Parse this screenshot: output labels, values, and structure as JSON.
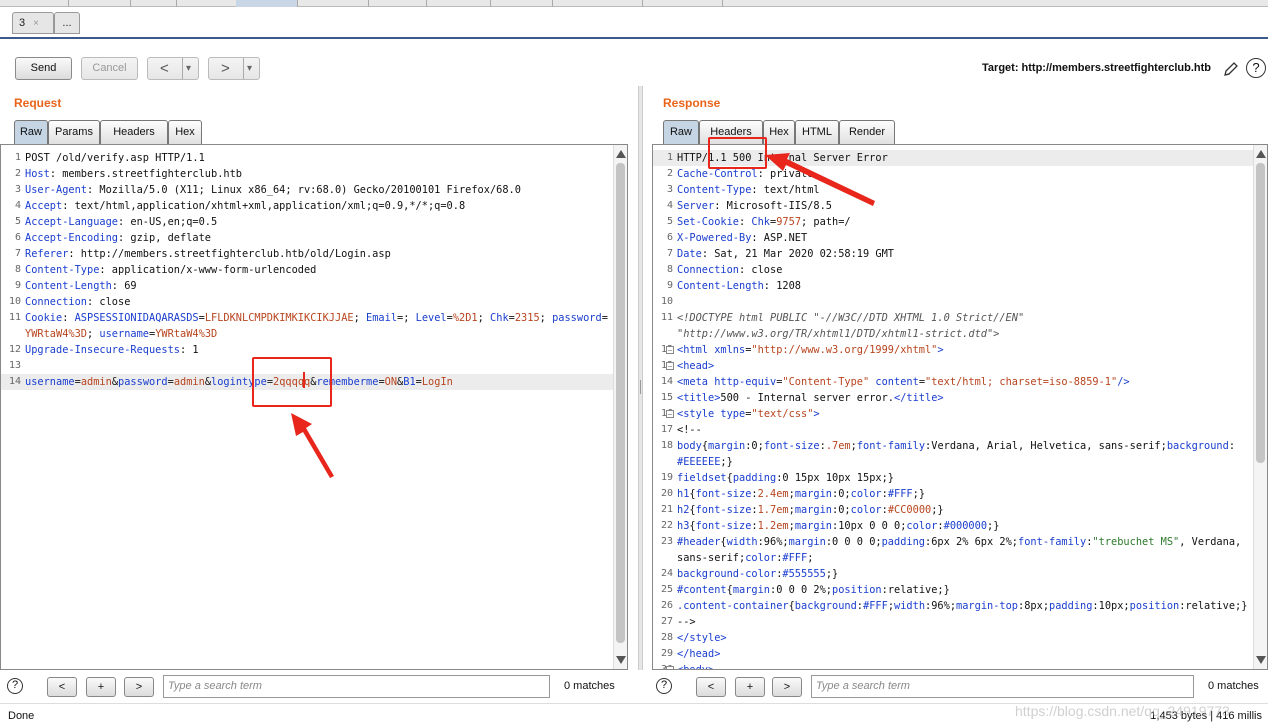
{
  "top_tabs": {
    "repeater_tab": "3",
    "close_glyph": "×",
    "new_tab": "..."
  },
  "toolbar": {
    "send": "Send",
    "cancel": "Cancel",
    "back": "<",
    "forward": ">",
    "dropdown": "▾",
    "target": "Target: http://members.streetfighterclub.htb",
    "help": "?"
  },
  "request": {
    "title": "Request",
    "tabs": [
      "Raw",
      "Params",
      "Headers",
      "Hex"
    ],
    "lines": [
      {
        "n": "1",
        "html": "POST /old/verify.asp HTTP/1.1"
      },
      {
        "n": "2",
        "html": "<span class='k'>Host</span>: members.streetfighterclub.htb"
      },
      {
        "n": "3",
        "html": "<span class='k'>User-Agent</span>: Mozilla/5.0 (X11; Linux x86_64; rv:68.0) Gecko/20100101 Firefox/68.0"
      },
      {
        "n": "4",
        "html": "<span class='k'>Accept</span>: text/html,application/xhtml+xml,application/xml;q=0.9,*/*;q=0.8"
      },
      {
        "n": "5",
        "html": "<span class='k'>Accept-Language</span>: en-US,en;q=0.5"
      },
      {
        "n": "6",
        "html": "<span class='k'>Accept-Encoding</span>: gzip, deflate"
      },
      {
        "n": "7",
        "html": "<span class='k'>Referer</span>: http://members.streetfighterclub.htb/old/Login.asp"
      },
      {
        "n": "8",
        "html": "<span class='k'>Content-Type</span>: application/x-www-form-urlencoded"
      },
      {
        "n": "9",
        "html": "<span class='k'>Content-Length</span>: 69"
      },
      {
        "n": "10",
        "html": "<span class='k'>Connection</span>: close"
      },
      {
        "n": "11",
        "html": "<span class='k'>Cookie</span>: <span class='k'>ASPSESSIONIDAQARASDS</span>=<span class='v'>LFLDKNLCMPDKIMKIKCIKJJAE</span>; <span class='k'>Email</span>=; <span class='k'>Level</span>=<span class='v'>%2D1</span>; <span class='k'>Chk</span>=<span class='v'>2315</span>; <span class='k'>password</span>="
      },
      {
        "n": "",
        "html": "<span class='v'>YWRtaW4%3D</span>; <span class='k'>username</span>=<span class='v'>YWRtaW4%3D</span>"
      },
      {
        "n": "12",
        "html": "<span class='k'>Upgrade-Insecure-Requests</span>: 1"
      },
      {
        "n": "13",
        "html": ""
      },
      {
        "n": "14",
        "html": "<span class='k'>username</span>=<span class='v'>admin</span>&amp;<span class='k'>password</span>=<span class='v'>admin</span>&amp;<span class='k'>logintype</span>=<span class='v'>2qqqqq</span>&amp;<span class='k'>rememberme</span>=<span class='v'>ON</span>&amp;<span class='k'>B1</span>=<span class='v'>LogIn</span>",
        "hl": true
      }
    ],
    "search_placeholder": "Type a search term",
    "matches": "0 matches"
  },
  "response": {
    "title": "Response",
    "tabs": [
      "Raw",
      "Headers",
      "Hex",
      "HTML",
      "Render"
    ],
    "lines": [
      {
        "n": "1",
        "html": "HTTP/1.1 500 Internal Server Error",
        "hl": true
      },
      {
        "n": "2",
        "html": "<span class='k'>Cache-Control</span>: private"
      },
      {
        "n": "3",
        "html": "<span class='k'>Content-Type</span>: text/html"
      },
      {
        "n": "4",
        "html": "<span class='k'>Server</span>: Microsoft-IIS/8.5"
      },
      {
        "n": "5",
        "html": "<span class='k'>Set-Cookie</span>: <span class='k'>Chk</span>=<span class='v'>9757</span>; path=/"
      },
      {
        "n": "6",
        "html": "<span class='k'>X-Powered-By</span>: ASP.NET"
      },
      {
        "n": "7",
        "html": "<span class='k'>Date</span>: Sat, 21 Mar 2020 02:58:19 GMT"
      },
      {
        "n": "8",
        "html": "<span class='k'>Connection</span>: close"
      },
      {
        "n": "9",
        "html": "<span class='k'>Content-Length</span>: 1208"
      },
      {
        "n": "10",
        "html": ""
      },
      {
        "n": "11",
        "html": "<span class='cm'>&lt;!DOCTYPE html PUBLIC \"-//W3C//DTD XHTML 1.0 Strict//EN\"</span>"
      },
      {
        "n": "",
        "html": "<span class='cm'>\"http://www.w3.org/TR/xhtml1/DTD/xhtml1-strict.dtd\"&gt;</span>"
      },
      {
        "n": "12",
        "fold": true,
        "html": "<span class='tg'>&lt;html</span> <span class='k'>xmlns</span>=<span class='v'>\"http://www.w3.org/1999/xhtml\"</span><span class='tg'>&gt;</span>"
      },
      {
        "n": "13",
        "fold": true,
        "html": "<span class='tg'>&lt;head&gt;</span>"
      },
      {
        "n": "14",
        "html": "<span class='tg'>&lt;meta</span> <span class='k'>http-equiv</span>=<span class='v'>\"Content-Type\"</span> <span class='k'>content</span>=<span class='v'>\"text/html; charset=iso-8859-1\"</span><span class='tg'>/&gt;</span>"
      },
      {
        "n": "15",
        "html": "<span class='tg'>&lt;title&gt;</span>500 - Internal server error.<span class='tg'>&lt;/title&gt;</span>"
      },
      {
        "n": "16",
        "fold": true,
        "html": "<span class='tg'>&lt;style</span> <span class='k'>type</span>=<span class='v'>\"text/css\"</span><span class='tg'>&gt;</span>"
      },
      {
        "n": "17",
        "html": "&lt;!--"
      },
      {
        "n": "18",
        "html": "<span class='k'>body</span>{<span class='k'>margin</span>:0;<span class='k'>font-size</span>:<span class='v'>.7em</span>;<span class='k'>font-family</span>:Verdana, Arial, Helvetica, sans-serif;<span class='k'>background</span>:"
      },
      {
        "n": "",
        "html": "<span class='k'>#EEEEEE</span>;}"
      },
      {
        "n": "19",
        "html": "<span class='k'>fieldset</span>{<span class='k'>padding</span>:0 15px 10px 15px;}"
      },
      {
        "n": "20",
        "html": "<span class='k'>h1</span>{<span class='k'>font-size</span>:<span class='v'>2.4em</span>;<span class='k'>margin</span>:0;<span class='k'>color</span>:<span class='k'>#FFF</span>;}"
      },
      {
        "n": "21",
        "html": "<span class='k'>h2</span>{<span class='k'>font-size</span>:<span class='v'>1.7em</span>;<span class='k'>margin</span>:0;<span class='k'>color</span>:<span class='v'>#CC0000</span>;}"
      },
      {
        "n": "22",
        "html": "<span class='k'>h3</span>{<span class='k'>font-size</span>:<span class='v'>1.2em</span>;<span class='k'>margin</span>:10px 0 0 0;<span class='k'>color</span>:<span class='k'>#000000</span>;}"
      },
      {
        "n": "23",
        "html": "<span class='k'>#header</span>{<span class='k'>width</span>:96%;<span class='k'>margin</span>:0 0 0 0;<span class='k'>padding</span>:6px 2% 6px 2%;<span class='k'>font-family</span>:<span class='c'>\"trebuchet MS\"</span>, Verdana,"
      },
      {
        "n": "",
        "html": "sans-serif;<span class='k'>color</span>:<span class='k'>#FFF</span>;"
      },
      {
        "n": "24",
        "html": "<span class='k'>background-color</span>:<span class='k'>#555555</span>;}"
      },
      {
        "n": "25",
        "html": "<span class='k'>#content</span>{<span class='k'>margin</span>:0 0 0 2%;<span class='k'>position</span>:relative;}"
      },
      {
        "n": "26",
        "html": "<span class='k'>.content-container</span>{<span class='k'>background</span>:<span class='k'>#FFF</span>;<span class='k'>width</span>:96%;<span class='k'>margin-top</span>:8px;<span class='k'>padding</span>:10px;<span class='k'>position</span>:relative;}"
      },
      {
        "n": "27",
        "html": "--&gt;"
      },
      {
        "n": "28",
        "html": "<span class='tg'>&lt;/style&gt;</span>"
      },
      {
        "n": "29",
        "html": "<span class='tg'>&lt;/head&gt;</span>"
      },
      {
        "n": "30",
        "fold": true,
        "html": "<span class='tg'>&lt;body&gt;</span>"
      }
    ],
    "search_placeholder": "Type a search term",
    "matches": "0 matches"
  },
  "search_nav": {
    "prev": "<",
    "add": "+",
    "next": ">"
  },
  "status": {
    "left": "Done",
    "right": "1,453 bytes | 416 millis"
  },
  "watermark": "https://blog.csdn.net/qq_24919773",
  "colors": {
    "accent": "#e8641a",
    "annotation_red": "#e8261c",
    "keyword": "#1a3ecf",
    "value": "#b8441e"
  }
}
